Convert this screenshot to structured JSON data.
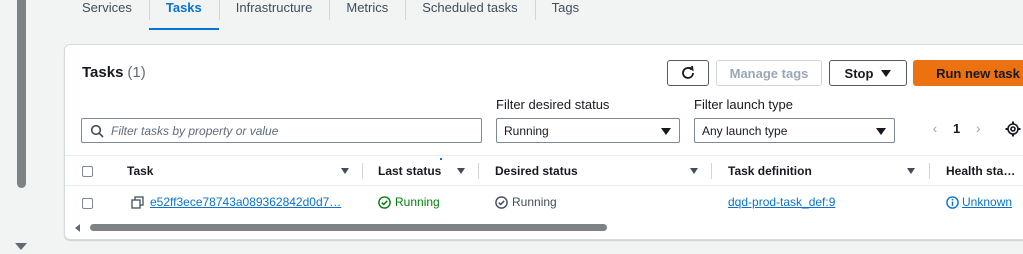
{
  "tabs": [
    "Services",
    "Tasks",
    "Infrastructure",
    "Metrics",
    "Scheduled tasks",
    "Tags"
  ],
  "active_tab": "Tasks",
  "panel": {
    "title": "Tasks",
    "count": "(1)",
    "buttons": {
      "refresh_icon": "refresh-icon",
      "manage_tags": "Manage tags",
      "stop": "Stop",
      "run_new_task": "Run new task"
    },
    "filters": {
      "search_placeholder": "Filter tasks by property or value",
      "desired_status_label": "Filter desired status",
      "desired_status_value": "Running",
      "launch_type_label": "Filter launch type",
      "launch_type_value": "Any launch type"
    },
    "pagination": {
      "page": "1"
    }
  },
  "table": {
    "columns": {
      "task": "Task",
      "last_status": "Last status",
      "desired_status": "Desired status",
      "task_definition": "Task definition",
      "health_status": "Health sta…"
    },
    "rows": [
      {
        "task": "e52ff3ece78743a089362842d0d7…",
        "last_status": "Running",
        "desired_status": "Running",
        "task_definition": "dqd-prod-task_def:9",
        "health_status": "Unknown"
      }
    ]
  },
  "colors": {
    "accent": "#0972d3",
    "primary_button": "#ec7211",
    "success": "#037f0c"
  }
}
